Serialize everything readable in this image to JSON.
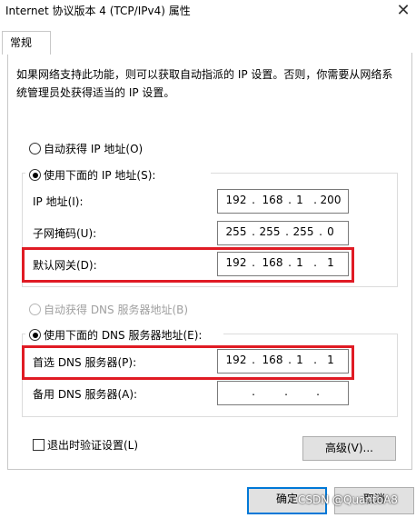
{
  "window": {
    "title": "Internet 协议版本 4 (TCP/IPv4) 属性",
    "close_glyph": "✕"
  },
  "tabs": [
    {
      "label": "常规",
      "selected": true
    }
  ],
  "description": "如果网络支持此功能，则可以获取自动指派的 IP 设置。否则，你需要从网络系统管理员处获得适当的 IP 设置。",
  "ip": {
    "auto_label": "自动获得 IP 地址(O)",
    "manual_label": "使用下面的 IP 地址(S):",
    "selected": "manual",
    "address_label": "IP 地址(I):",
    "address": [
      "192",
      "168",
      "1",
      "200"
    ],
    "mask_label": "子网掩码(U):",
    "mask": [
      "255",
      "255",
      "255",
      "0"
    ],
    "gateway_label": "默认网关(D):",
    "gateway": [
      "192",
      "168",
      "1",
      "1"
    ]
  },
  "dns": {
    "auto_label": "自动获得 DNS 服务器地址(B)",
    "auto_disabled": true,
    "manual_label": "使用下面的 DNS 服务器地址(E):",
    "selected": "manual",
    "preferred_label": "首选 DNS 服务器(P):",
    "preferred": [
      "192",
      "168",
      "1",
      "1"
    ],
    "alternate_label": "备用 DNS 服务器(A):",
    "alternate": [
      "",
      "",
      "",
      ""
    ]
  },
  "validate_label": "退出时验证设置(L)",
  "validate_checked": false,
  "advanced_label": "高级(V)...",
  "ok_label": "确定",
  "cancel_label": "取消",
  "watermark": "CSDN @QuantoA8",
  "colors": {
    "highlight": "#e01b24",
    "primary_border": "#0078d7"
  }
}
